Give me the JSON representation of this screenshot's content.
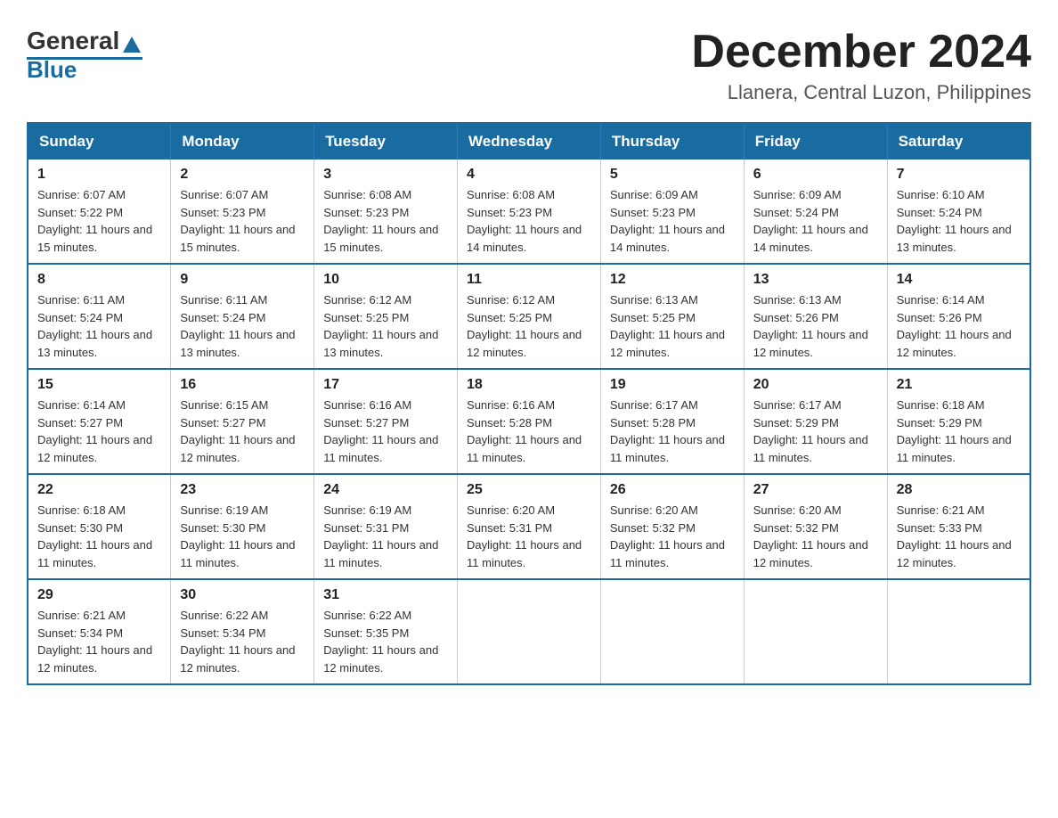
{
  "header": {
    "logo_general": "General",
    "logo_blue": "Blue",
    "month_year": "December 2024",
    "location": "Llanera, Central Luzon, Philippines"
  },
  "days_of_week": [
    "Sunday",
    "Monday",
    "Tuesday",
    "Wednesday",
    "Thursday",
    "Friday",
    "Saturday"
  ],
  "weeks": [
    [
      {
        "day": "1",
        "sunrise": "6:07 AM",
        "sunset": "5:22 PM",
        "daylight": "11 hours and 15 minutes."
      },
      {
        "day": "2",
        "sunrise": "6:07 AM",
        "sunset": "5:23 PM",
        "daylight": "11 hours and 15 minutes."
      },
      {
        "day": "3",
        "sunrise": "6:08 AM",
        "sunset": "5:23 PM",
        "daylight": "11 hours and 15 minutes."
      },
      {
        "day": "4",
        "sunrise": "6:08 AM",
        "sunset": "5:23 PM",
        "daylight": "11 hours and 14 minutes."
      },
      {
        "day": "5",
        "sunrise": "6:09 AM",
        "sunset": "5:23 PM",
        "daylight": "11 hours and 14 minutes."
      },
      {
        "day": "6",
        "sunrise": "6:09 AM",
        "sunset": "5:24 PM",
        "daylight": "11 hours and 14 minutes."
      },
      {
        "day": "7",
        "sunrise": "6:10 AM",
        "sunset": "5:24 PM",
        "daylight": "11 hours and 13 minutes."
      }
    ],
    [
      {
        "day": "8",
        "sunrise": "6:11 AM",
        "sunset": "5:24 PM",
        "daylight": "11 hours and 13 minutes."
      },
      {
        "day": "9",
        "sunrise": "6:11 AM",
        "sunset": "5:24 PM",
        "daylight": "11 hours and 13 minutes."
      },
      {
        "day": "10",
        "sunrise": "6:12 AM",
        "sunset": "5:25 PM",
        "daylight": "11 hours and 13 minutes."
      },
      {
        "day": "11",
        "sunrise": "6:12 AM",
        "sunset": "5:25 PM",
        "daylight": "11 hours and 12 minutes."
      },
      {
        "day": "12",
        "sunrise": "6:13 AM",
        "sunset": "5:25 PM",
        "daylight": "11 hours and 12 minutes."
      },
      {
        "day": "13",
        "sunrise": "6:13 AM",
        "sunset": "5:26 PM",
        "daylight": "11 hours and 12 minutes."
      },
      {
        "day": "14",
        "sunrise": "6:14 AM",
        "sunset": "5:26 PM",
        "daylight": "11 hours and 12 minutes."
      }
    ],
    [
      {
        "day": "15",
        "sunrise": "6:14 AM",
        "sunset": "5:27 PM",
        "daylight": "11 hours and 12 minutes."
      },
      {
        "day": "16",
        "sunrise": "6:15 AM",
        "sunset": "5:27 PM",
        "daylight": "11 hours and 12 minutes."
      },
      {
        "day": "17",
        "sunrise": "6:16 AM",
        "sunset": "5:27 PM",
        "daylight": "11 hours and 11 minutes."
      },
      {
        "day": "18",
        "sunrise": "6:16 AM",
        "sunset": "5:28 PM",
        "daylight": "11 hours and 11 minutes."
      },
      {
        "day": "19",
        "sunrise": "6:17 AM",
        "sunset": "5:28 PM",
        "daylight": "11 hours and 11 minutes."
      },
      {
        "day": "20",
        "sunrise": "6:17 AM",
        "sunset": "5:29 PM",
        "daylight": "11 hours and 11 minutes."
      },
      {
        "day": "21",
        "sunrise": "6:18 AM",
        "sunset": "5:29 PM",
        "daylight": "11 hours and 11 minutes."
      }
    ],
    [
      {
        "day": "22",
        "sunrise": "6:18 AM",
        "sunset": "5:30 PM",
        "daylight": "11 hours and 11 minutes."
      },
      {
        "day": "23",
        "sunrise": "6:19 AM",
        "sunset": "5:30 PM",
        "daylight": "11 hours and 11 minutes."
      },
      {
        "day": "24",
        "sunrise": "6:19 AM",
        "sunset": "5:31 PM",
        "daylight": "11 hours and 11 minutes."
      },
      {
        "day": "25",
        "sunrise": "6:20 AM",
        "sunset": "5:31 PM",
        "daylight": "11 hours and 11 minutes."
      },
      {
        "day": "26",
        "sunrise": "6:20 AM",
        "sunset": "5:32 PM",
        "daylight": "11 hours and 11 minutes."
      },
      {
        "day": "27",
        "sunrise": "6:20 AM",
        "sunset": "5:32 PM",
        "daylight": "11 hours and 12 minutes."
      },
      {
        "day": "28",
        "sunrise": "6:21 AM",
        "sunset": "5:33 PM",
        "daylight": "11 hours and 12 minutes."
      }
    ],
    [
      {
        "day": "29",
        "sunrise": "6:21 AM",
        "sunset": "5:34 PM",
        "daylight": "11 hours and 12 minutes."
      },
      {
        "day": "30",
        "sunrise": "6:22 AM",
        "sunset": "5:34 PM",
        "daylight": "11 hours and 12 minutes."
      },
      {
        "day": "31",
        "sunrise": "6:22 AM",
        "sunset": "5:35 PM",
        "daylight": "11 hours and 12 minutes."
      },
      null,
      null,
      null,
      null
    ]
  ],
  "labels": {
    "sunrise_prefix": "Sunrise: ",
    "sunset_prefix": "Sunset: ",
    "daylight_prefix": "Daylight: "
  }
}
